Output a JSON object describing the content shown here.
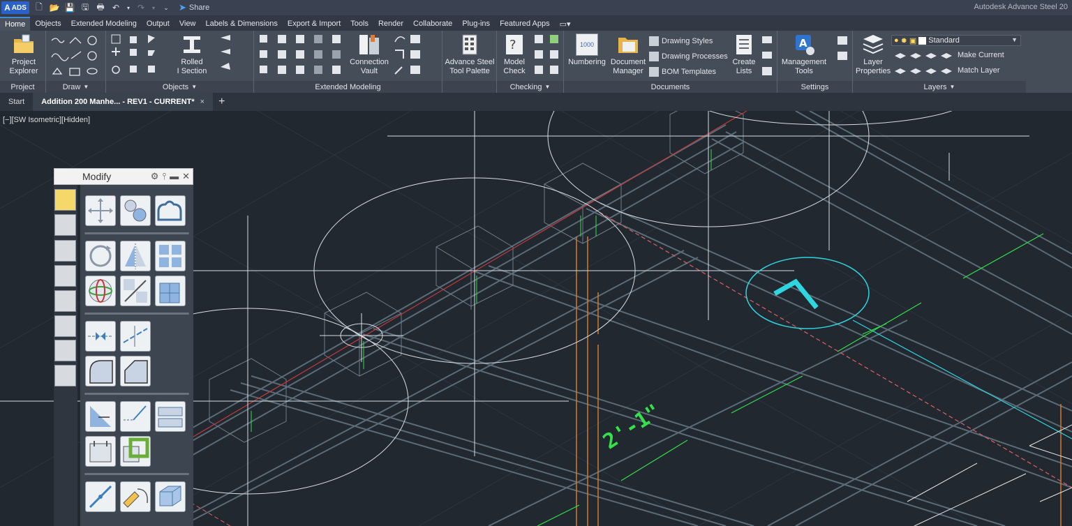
{
  "titlebar": {
    "logo_label": "ADS",
    "logo_letter": "A",
    "share_label": "Share",
    "app_title": "Autodesk Advance Steel 20"
  },
  "ribbon_tabs": [
    "Home",
    "Objects",
    "Extended Modeling",
    "Output",
    "View",
    "Labels & Dimensions",
    "Export & Import",
    "Tools",
    "Render",
    "Collaborate",
    "Plug-ins",
    "Featured Apps"
  ],
  "active_tab": "Home",
  "panels": {
    "project": {
      "title": "Project",
      "project_explorer": "Project\nExplorer"
    },
    "draw": {
      "title": "Draw"
    },
    "objects": {
      "title": "Objects",
      "rolled_section": "Rolled\nI Section"
    },
    "extended": {
      "title": "Extended Modeling",
      "connection_vault": "Connection\nVault",
      "tool_palette": "Advance Steel\nTool Palette"
    },
    "checking": {
      "title": "Checking",
      "model_check": "Model\nCheck"
    },
    "documents": {
      "title": "Documents",
      "numbering": "Numbering",
      "numbering_badge": "1000",
      "document_manager": "Document\nManager",
      "drawing_styles": "Drawing Styles",
      "drawing_processes": "Drawing Processes",
      "bom_templates": "BOM Templates",
      "create_lists": "Create\nLists"
    },
    "settings": {
      "title": "Settings",
      "management_tools": "Management\nTools"
    },
    "layers": {
      "title": "Layers",
      "layer_properties": "Layer\nProperties",
      "current_layer": "Standard",
      "make_current": "Make Current",
      "match_layer": "Match Layer"
    }
  },
  "doc_tabs": {
    "start": "Start",
    "current": "Addition 200 Manhe... - REV1 - CURRENT*",
    "close": "×",
    "new": "+"
  },
  "viewport": {
    "label": "[−][SW Isometric][Hidden]",
    "dimension_text": "2'-1\""
  },
  "modify_palette": {
    "title": "Modify"
  },
  "colors": {
    "background": "#212830",
    "beam": "#5b6b78",
    "grid": "#d8dde3",
    "accent_cyan": "#2fd6e0",
    "dimension_green": "#35e04a",
    "column_orange": "#d07a28",
    "axis_red": "#c23a3a"
  }
}
